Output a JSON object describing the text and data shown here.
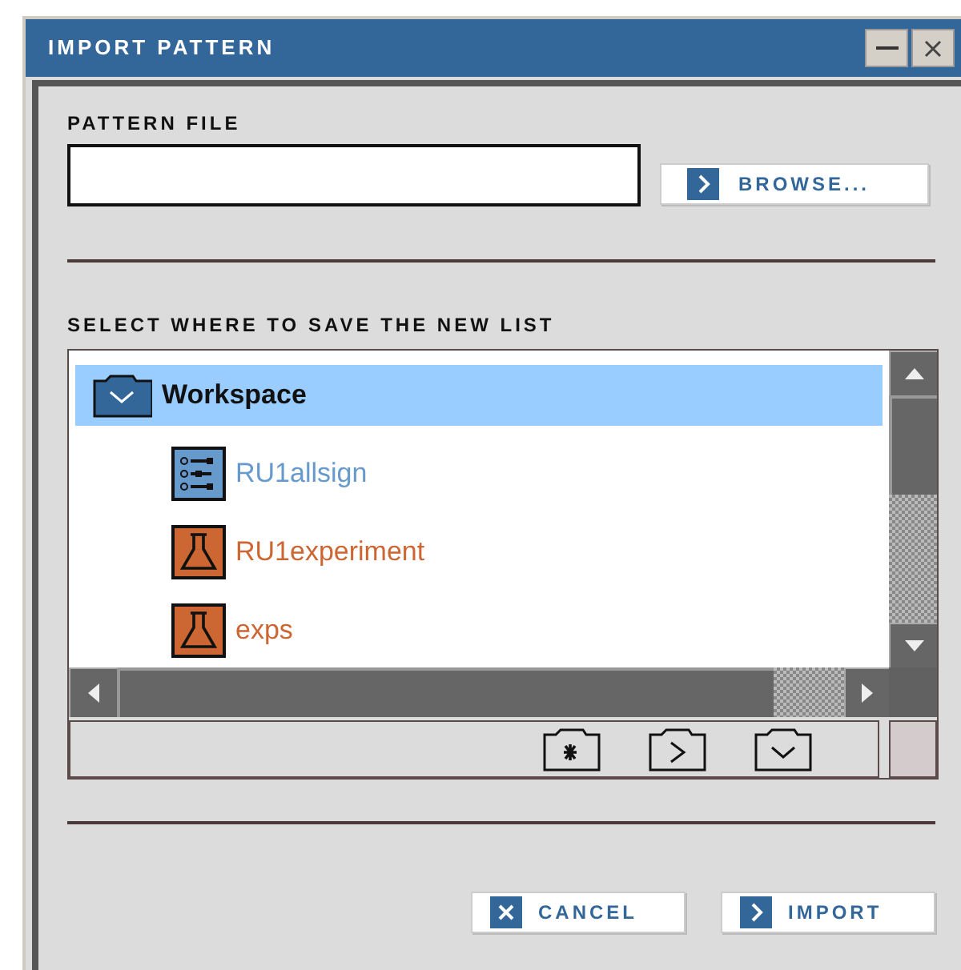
{
  "window": {
    "title": "IMPORT PATTERN"
  },
  "pattern_file": {
    "label": "PATTERN FILE"
  },
  "browse_button": {
    "label": "BROWSE..."
  },
  "tree": {
    "label": "SELECT WHERE TO SAVE THE NEW LIST",
    "items": [
      {
        "label": "Workspace",
        "kind": "folder",
        "selected": true,
        "expanded": true,
        "children": [
          {
            "label": "RU1allsign",
            "kind": "list",
            "selected": false
          },
          {
            "label": "RU1experiment",
            "kind": "experiment",
            "selected": false
          },
          {
            "label": "exps",
            "kind": "experiment",
            "selected": false
          }
        ]
      }
    ]
  },
  "buttons": [
    {
      "label": "CANCEL",
      "kind": "cancel"
    },
    {
      "label": "IMPORT",
      "kind": "confirm"
    }
  ]
}
